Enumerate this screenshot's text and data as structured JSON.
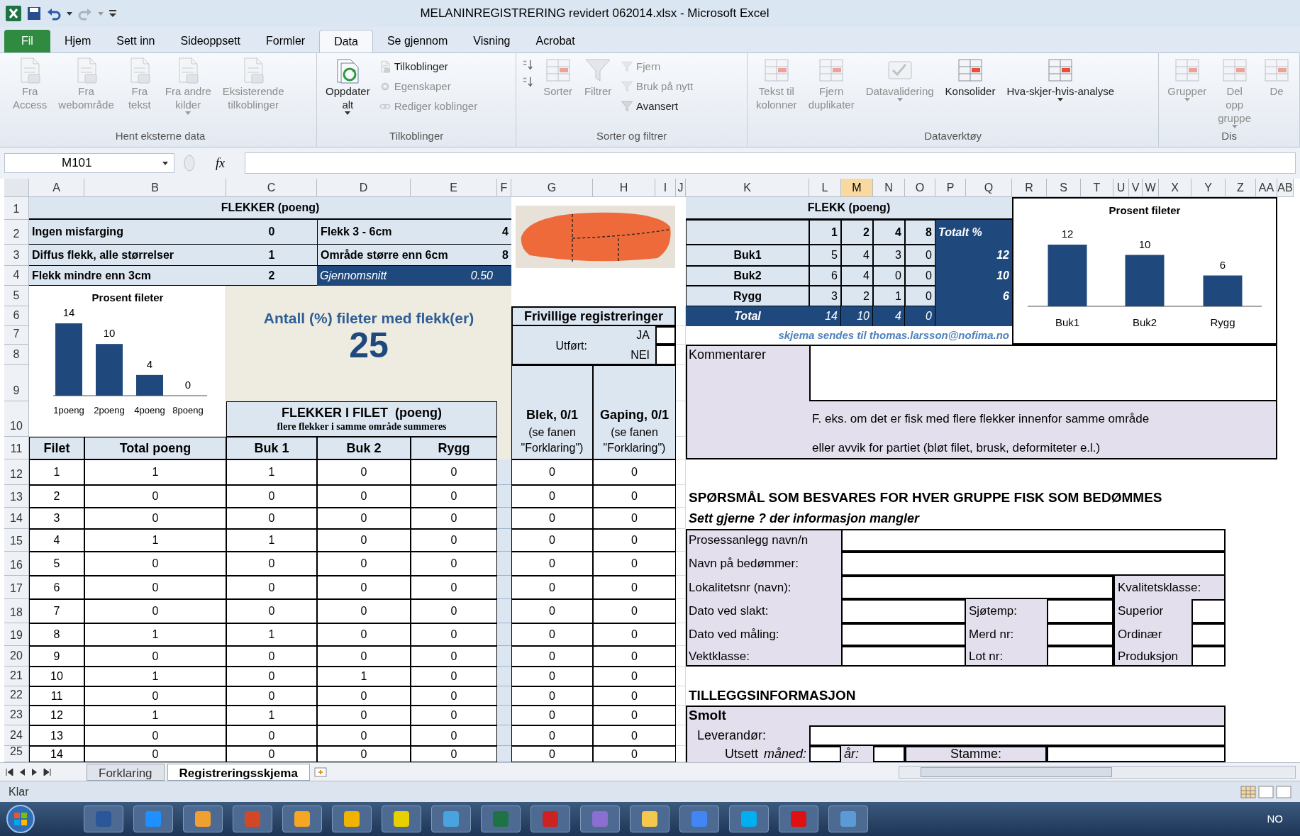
{
  "window": {
    "title": "MELANINREGISTRERING revidert 062014.xlsx  -  Microsoft Excel"
  },
  "ribbon_tabs": [
    {
      "label": "Fil",
      "kind": "file",
      "selected": false
    },
    {
      "label": "Hjem",
      "kind": "tab",
      "selected": false
    },
    {
      "label": "Sett inn",
      "kind": "tab",
      "selected": false
    },
    {
      "label": "Sideoppsett",
      "kind": "tab",
      "selected": false
    },
    {
      "label": "Formler",
      "kind": "tab",
      "selected": false
    },
    {
      "label": "Data",
      "kind": "tab",
      "selected": true
    },
    {
      "label": "Se gjennom",
      "kind": "tab",
      "selected": false
    },
    {
      "label": "Visning",
      "kind": "tab",
      "selected": false
    },
    {
      "label": "Acrobat",
      "kind": "tab",
      "selected": false
    }
  ],
  "ribbon_groups": [
    {
      "label": "Hent eksterne data",
      "items": [
        {
          "kind": "large",
          "lines": [
            "Fra",
            "Access"
          ],
          "disabled": true,
          "dropdown": false
        },
        {
          "kind": "large",
          "lines": [
            "Fra",
            "webområde"
          ],
          "disabled": true,
          "dropdown": false
        },
        {
          "kind": "large",
          "lines": [
            "Fra",
            "tekst"
          ],
          "disabled": true,
          "dropdown": false
        },
        {
          "kind": "large",
          "lines": [
            "Fra andre",
            "kilder"
          ],
          "disabled": true,
          "dropdown": true
        },
        {
          "kind": "large",
          "lines": [
            "Eksisterende",
            "tilkoblinger"
          ],
          "disabled": true,
          "dropdown": false
        }
      ]
    },
    {
      "label": "Tilkoblinger",
      "items": [
        {
          "kind": "large",
          "lines": [
            "Oppdater",
            "alt"
          ],
          "disabled": false,
          "dropdown": true
        },
        {
          "kind": "small",
          "lines": [
            "Tilkoblinger"
          ],
          "disabled": false
        },
        {
          "kind": "small",
          "lines": [
            "Egenskaper"
          ],
          "disabled": true
        },
        {
          "kind": "small",
          "lines": [
            "Rediger koblinger"
          ],
          "disabled": true
        }
      ]
    },
    {
      "label": "Sorter og filtrer",
      "items": [
        {
          "kind": "icon",
          "disabled": false
        },
        {
          "kind": "icon",
          "disabled": false
        },
        {
          "kind": "large",
          "lines": [
            "Sorter"
          ],
          "disabled": true,
          "dropdown": false
        },
        {
          "kind": "large",
          "lines": [
            "Filtrer"
          ],
          "disabled": true,
          "dropdown": false
        },
        {
          "kind": "small",
          "lines": [
            "Fjern"
          ],
          "disabled": true
        },
        {
          "kind": "small",
          "lines": [
            "Bruk på nytt"
          ],
          "disabled": true
        },
        {
          "kind": "small",
          "lines": [
            "Avansert"
          ],
          "disabled": false
        }
      ]
    },
    {
      "label": "Dataverktøy",
      "items": [
        {
          "kind": "large",
          "lines": [
            "Tekst til",
            "kolonner"
          ],
          "disabled": true,
          "dropdown": false
        },
        {
          "kind": "large",
          "lines": [
            "Fjern",
            "duplikater"
          ],
          "disabled": true,
          "dropdown": false
        },
        {
          "kind": "large",
          "lines": [
            "Datavalidering"
          ],
          "disabled": true,
          "dropdown": true
        },
        {
          "kind": "large",
          "lines": [
            "Konsolider"
          ],
          "disabled": false,
          "dropdown": false
        },
        {
          "kind": "large",
          "lines": [
            "Hva-skjer-hvis-analyse"
          ],
          "disabled": false,
          "dropdown": true
        }
      ]
    },
    {
      "label": "Dis",
      "items": [
        {
          "kind": "large",
          "lines": [
            "Grupper"
          ],
          "disabled": true,
          "dropdown": true
        },
        {
          "kind": "large",
          "lines": [
            "Del opp",
            "gruppe"
          ],
          "disabled": true,
          "dropdown": true
        },
        {
          "kind": "large",
          "lines": [
            "De"
          ],
          "disabled": true,
          "dropdown": false
        }
      ]
    }
  ],
  "formula_bar": {
    "name_box": "M101",
    "function_label": "fx"
  },
  "sheet": {
    "columns": [
      {
        "label": "A",
        "selected": false
      },
      {
        "label": "B",
        "selected": false
      },
      {
        "label": "C",
        "selected": false
      },
      {
        "label": "D",
        "selected": false
      },
      {
        "label": "E",
        "selected": false
      },
      {
        "label": "F",
        "selected": false
      },
      {
        "label": "G",
        "selected": false
      },
      {
        "label": "H",
        "selected": false
      },
      {
        "label": "I",
        "selected": false
      },
      {
        "label": "J",
        "selected": false
      },
      {
        "label": "K",
        "selected": false
      },
      {
        "label": "L",
        "selected": false
      },
      {
        "label": "M",
        "selected": true
      },
      {
        "label": "N",
        "selected": false
      },
      {
        "label": "O",
        "selected": false
      },
      {
        "label": "P",
        "selected": false
      },
      {
        "label": "Q",
        "selected": false
      },
      {
        "label": "R",
        "selected": false
      },
      {
        "label": "S",
        "selected": false
      },
      {
        "label": "T",
        "selected": false
      },
      {
        "label": "U",
        "selected": false
      },
      {
        "label": "V",
        "selected": false
      },
      {
        "label": "W",
        "selected": false
      },
      {
        "label": "X",
        "selected": false
      },
      {
        "label": "Y",
        "selected": false
      },
      {
        "label": "Z",
        "selected": false
      },
      {
        "label": "AA",
        "selected": false
      },
      {
        "label": "AB",
        "selected": false
      }
    ],
    "row_headers": [
      "1",
      "2",
      "3",
      "4",
      "5",
      "6",
      "7",
      "8",
      "9",
      "10",
      "11",
      "12",
      "13",
      "14",
      "15",
      "16",
      "17",
      "18",
      "19",
      "20",
      "21",
      "22",
      "23",
      "24",
      "25"
    ]
  },
  "legend": {
    "title": "FLEKKER (poeng)",
    "items": [
      {
        "label": "Ingen misfarging",
        "score": "0"
      },
      {
        "label": "Diffus flekk, alle størrelser",
        "score": "1"
      },
      {
        "label": "Flekk mindre enn 3cm",
        "score": "2"
      },
      {
        "label": "Flekk 3 - 6cm",
        "score": "4"
      },
      {
        "label": "Område større enn 6cm",
        "score": "8"
      }
    ],
    "average": {
      "label": "Gjennomsnitt",
      "value": "0.50"
    }
  },
  "score_chart": {
    "chart_data": {
      "type": "bar",
      "title": "Prosent fileter",
      "categories": [
        "1poeng",
        "2poeng",
        "4poeng",
        "8poeng"
      ],
      "series": [
        {
          "color": "#1f497d",
          "values": [
            14,
            10,
            4,
            0
          ]
        }
      ],
      "data_labels": true
    }
  },
  "summary": {
    "label": "Antall (%) fileter med flekk(er)",
    "value": "25"
  },
  "voluntary": {
    "title": "Frivillige registreringer",
    "performed_label": "Utført:",
    "options": [
      "JA",
      "NEI"
    ]
  },
  "fillet_header": {
    "title": "FLEKKER I FILET  (poeng)",
    "subtitle": "flere flekker i samme område summeres"
  },
  "extra_headers": [
    {
      "title": "Blek, 0/1",
      "lines": [
        "(se fanen",
        "\"Forklaring\")"
      ]
    },
    {
      "title": "Gaping, 0/1",
      "lines": [
        "(se fanen",
        "\"Forklaring\")"
      ]
    }
  ],
  "table": {
    "columns": [
      "Filet",
      "Total poeng",
      "Buk 1",
      "Buk 2",
      "Rygg"
    ],
    "rows": [
      [
        "1",
        "1",
        "1",
        "0",
        "0",
        "0",
        "0"
      ],
      [
        "2",
        "0",
        "0",
        "0",
        "0",
        "0",
        "0"
      ],
      [
        "3",
        "0",
        "0",
        "0",
        "0",
        "0",
        "0"
      ],
      [
        "4",
        "1",
        "1",
        "0",
        "0",
        "0",
        "0"
      ],
      [
        "5",
        "0",
        "0",
        "0",
        "0",
        "0",
        "0"
      ],
      [
        "6",
        "0",
        "0",
        "0",
        "0",
        "0",
        "0"
      ],
      [
        "7",
        "0",
        "0",
        "0",
        "0",
        "0",
        "0"
      ],
      [
        "8",
        "1",
        "1",
        "0",
        "0",
        "0",
        "0"
      ],
      [
        "9",
        "0",
        "0",
        "0",
        "0",
        "0",
        "0"
      ],
      [
        "10",
        "1",
        "0",
        "1",
        "0",
        "0",
        "0"
      ],
      [
        "11",
        "0",
        "0",
        "0",
        "0",
        "0",
        "0"
      ],
      [
        "12",
        "1",
        "1",
        "0",
        "0",
        "0",
        "0"
      ],
      [
        "13",
        "0",
        "0",
        "0",
        "0",
        "0",
        "0"
      ],
      [
        "14",
        "0",
        "0",
        "0",
        "0",
        "0",
        "0"
      ]
    ]
  },
  "spot_table": {
    "title": "FLEKK (poeng)",
    "columns": [
      "1",
      "2",
      "4",
      "8"
    ],
    "total_label": "Totalt %",
    "rows": [
      {
        "label": "Buk1",
        "values": [
          "5",
          "4",
          "3",
          "0"
        ],
        "total": "12",
        "kind": "area"
      },
      {
        "label": "Buk2",
        "values": [
          "6",
          "4",
          "0",
          "0"
        ],
        "total": "10",
        "kind": "area"
      },
      {
        "label": "Rygg",
        "values": [
          "3",
          "2",
          "1",
          "0"
        ],
        "total": "6",
        "kind": "area"
      },
      {
        "label": "Total",
        "values": [
          "14",
          "10",
          "4",
          "0"
        ],
        "kind": "sum"
      }
    ]
  },
  "email_note": "skjema sendes til thomas.larsson@nofima.no",
  "area_chart": {
    "chart_data": {
      "type": "bar",
      "title": "Prosent fileter",
      "categories": [
        "Buk1",
        "Buk2",
        "Rygg"
      ],
      "series": [
        {
          "color": "#1f497d",
          "values": [
            12,
            10,
            6
          ]
        }
      ],
      "data_labels": true
    }
  },
  "comments": {
    "label": "Kommentarer",
    "hints": [
      "F. eks. om det er fisk med flere flekker innenfor samme område",
      "eller avvik for partiet (bløt filet, brusk, deformiteter e.l.)"
    ]
  },
  "questions": {
    "title": "SPØRSMÅL SOM BESVARES FOR HVER GRUPPE FISK SOM BEDØMMES",
    "subtitle": "Sett gjerne ? der informasjon mangler",
    "fields": [
      "Prosessanlegg navn/n",
      "Navn på bedømmer:",
      "Lokalitetsnr (navn):",
      "Dato ved slakt:",
      "Dato ved måling:",
      "Vektklasse:"
    ],
    "fields_2": [
      "Sjøtemp:",
      "Merd nr:",
      "Lot nr:"
    ],
    "quality": {
      "label": "Kvalitetsklasse:",
      "options": [
        "Superior",
        "Ordinær",
        "Produksjon"
      ]
    }
  },
  "additional": {
    "title": "TILLEGGSINFORMASJON",
    "section": "Smolt",
    "supplier_label": "Leverandør:",
    "release_label": "Utsett",
    "month_label": "måned:",
    "year_label": "år:",
    "strain_label": "Stamme:"
  },
  "sheet_tabs": [
    {
      "label": "Forklaring",
      "selected": false
    },
    {
      "label": "Registreringsskjema",
      "selected": true
    }
  ],
  "status_bar": {
    "text": "Klar"
  },
  "taskbar": {
    "language": "NO"
  }
}
